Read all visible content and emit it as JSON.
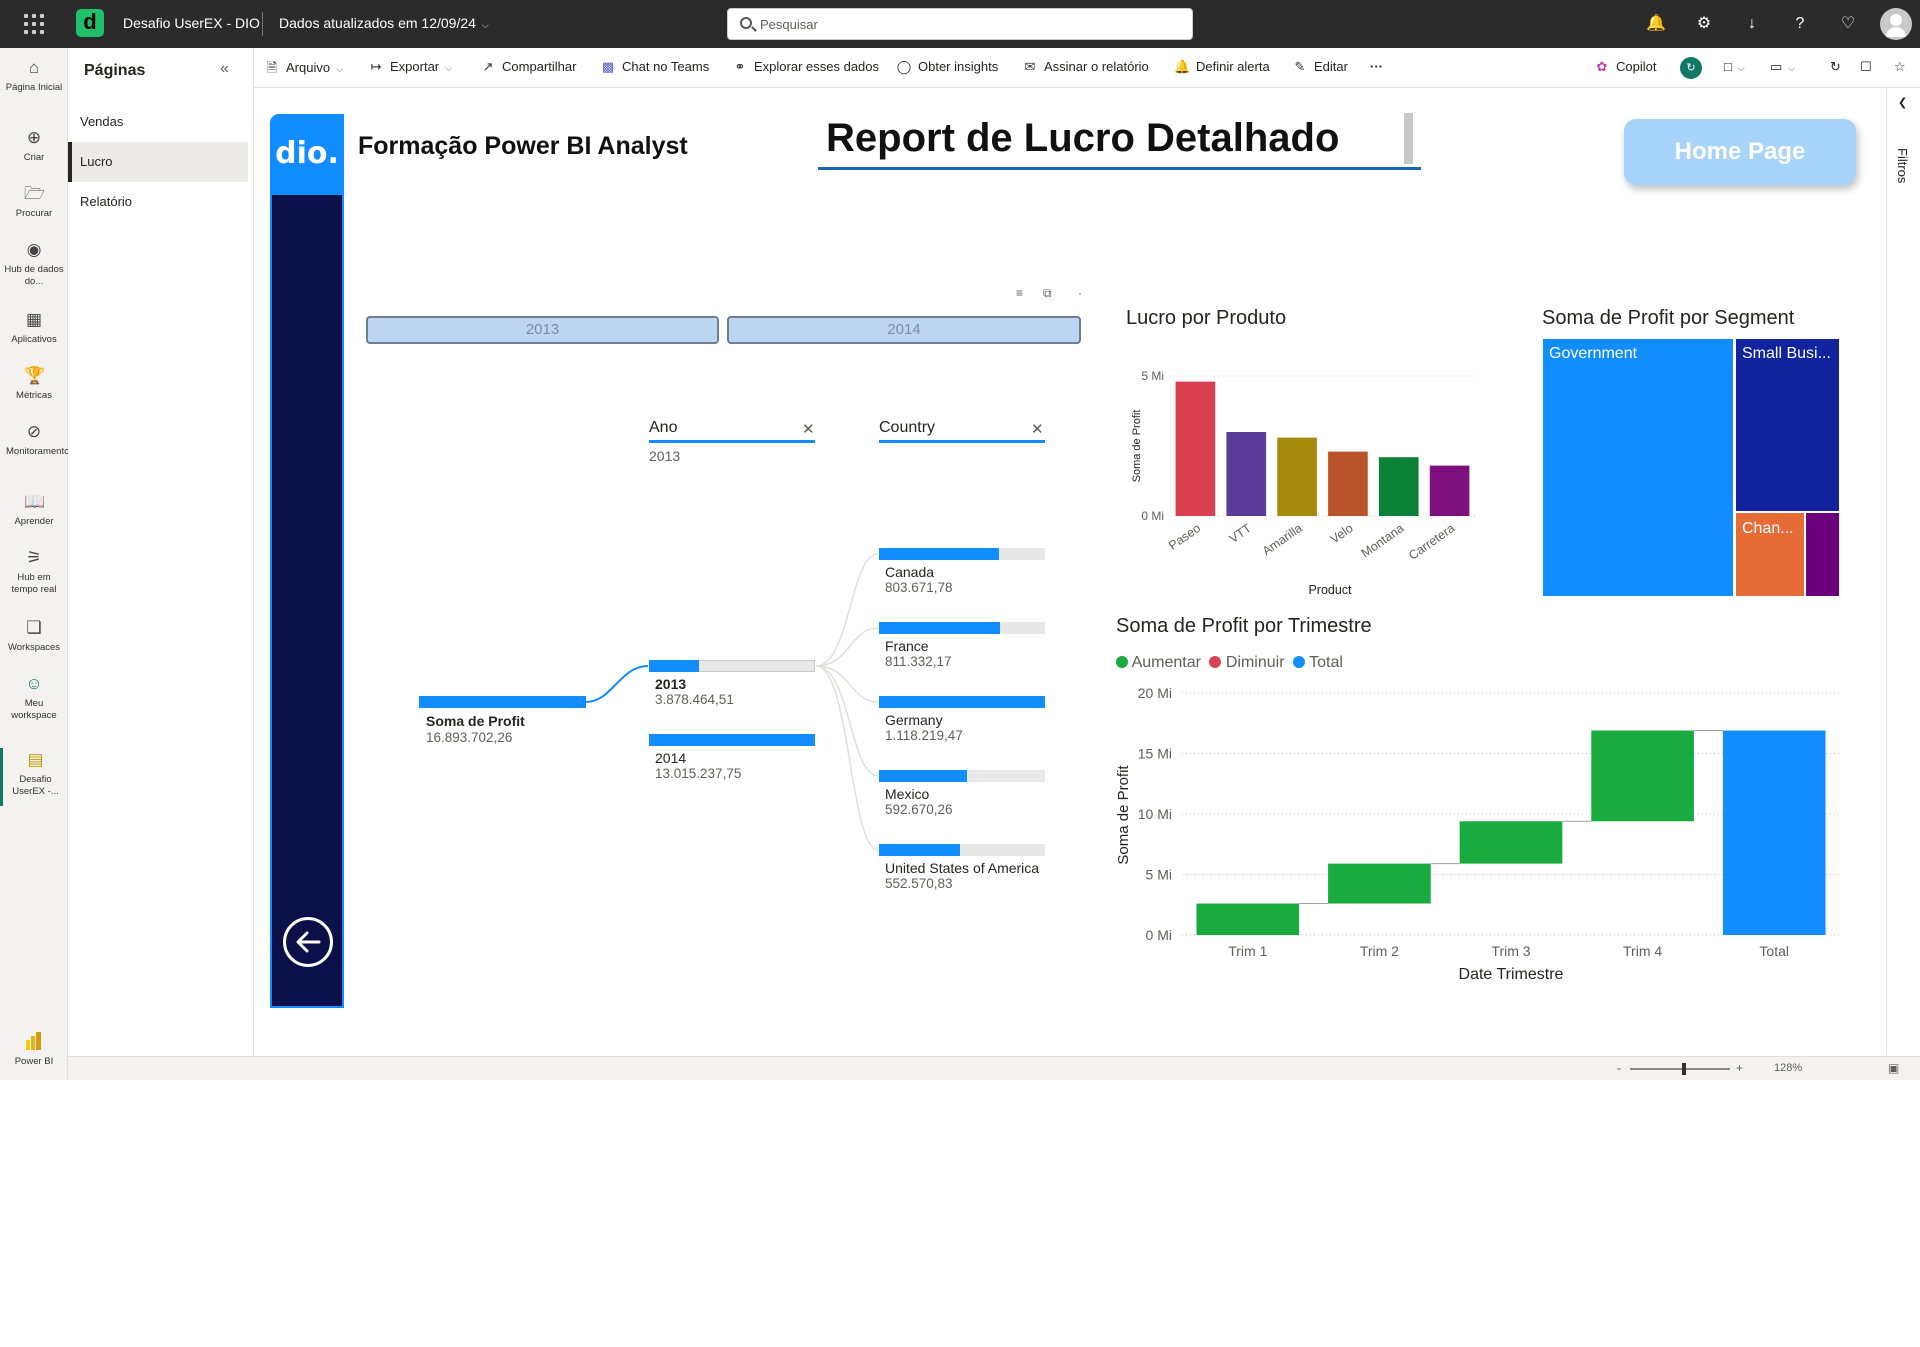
{
  "topbar": {
    "workspace_title": "Desafio UserEX - DIO",
    "updated_label": "Dados atualizados em 12/09/24",
    "search_placeholder": "Pesquisar"
  },
  "leftnav": [
    {
      "label": "Página Inicial",
      "icon": "home-icon"
    },
    {
      "label": "Criar",
      "icon": "plus-circle-icon"
    },
    {
      "label": "Procurar",
      "icon": "folder-icon"
    },
    {
      "label": "Hub de dados do...",
      "icon": "data-hub-icon"
    },
    {
      "label": "Aplicativos",
      "icon": "apps-icon"
    },
    {
      "label": "Métricas",
      "icon": "trophy-icon"
    },
    {
      "label": "Monitoramento",
      "icon": "monitor-icon"
    },
    {
      "label": "Aprender",
      "icon": "book-icon"
    },
    {
      "label": "Hub em tempo real",
      "icon": "realtime-icon"
    },
    {
      "label": "Workspaces",
      "icon": "workspaces-icon"
    },
    {
      "label": "Meu workspace",
      "icon": "person-icon"
    },
    {
      "label": "Desafio UserEX -...",
      "icon": "report-icon"
    }
  ],
  "powerbi_label": "Power BI",
  "pages_pane": {
    "header": "Páginas",
    "items": [
      "Vendas",
      "Lucro",
      "Relatório"
    ],
    "active": "Lucro"
  },
  "commands": {
    "arquivo": "Arquivo",
    "exportar": "Exportar",
    "compartilhar": "Compartilhar",
    "chat_teams": "Chat no Teams",
    "explorar": "Explorar esses dados",
    "insights": "Obter insights",
    "assinar": "Assinar o relatório",
    "alerta": "Definir alerta",
    "editar": "Editar",
    "more": "···",
    "copilot": "Copilot"
  },
  "filters_label": "Filtros",
  "zoom": "128%",
  "report": {
    "logo_text": "dio.",
    "left_title": "Formação Power BI Analyst",
    "main_title": "Report de Lucro Detalhado",
    "home_button": "Home Page",
    "slicer": [
      "2013",
      "2014"
    ]
  },
  "decomp": {
    "col1_header": "Ano",
    "col1_filter": "2013",
    "col2_header": "Country",
    "root": {
      "label": "Soma de Profit",
      "value": "16.893.702,26"
    },
    "years": [
      {
        "label": "2013",
        "value": "3.878.464,51",
        "fraction": 0.3
      },
      {
        "label": "2014",
        "value": "13.015.237,75",
        "fraction": 1.0
      }
    ],
    "countries": [
      {
        "label": "Canada",
        "value": "803.671,78",
        "fraction": 0.72
      },
      {
        "label": "France",
        "value": "811.332,17",
        "fraction": 0.73
      },
      {
        "label": "Germany",
        "value": "1.118.219,47",
        "fraction": 1.0
      },
      {
        "label": "Mexico",
        "value": "592.670,26",
        "fraction": 0.53
      },
      {
        "label": "United States of America",
        "value": "552.570,83",
        "fraction": 0.49
      }
    ]
  },
  "chart_data": [
    {
      "type": "bar",
      "title": "Lucro por Produto",
      "xlabel": "Product",
      "ylabel": "Soma de Profit",
      "yticks": [
        "0 Mi",
        "5 Mi"
      ],
      "ylim": [
        0,
        5
      ],
      "categories": [
        "Paseo",
        "VTT",
        "Amarilla",
        "Velo",
        "Montana",
        "Carretera"
      ],
      "values": [
        4.8,
        3.0,
        2.8,
        2.3,
        2.1,
        1.8
      ],
      "colors": [
        "#d9404f",
        "#5b3c99",
        "#a4890a",
        "#b9532a",
        "#0a8136",
        "#7f117e"
      ]
    },
    {
      "type": "heatmap",
      "subtype": "treemap",
      "title": "Soma de Profit por Segment",
      "cells": [
        {
          "label": "Government",
          "color": "#118dff"
        },
        {
          "label": "Small Busi...",
          "color": "#12239e"
        },
        {
          "label": "Chan...",
          "color": "#e66c37"
        },
        {
          "label": "",
          "color": "#6b007b"
        }
      ]
    },
    {
      "type": "bar",
      "subtype": "waterfall",
      "title": "Soma de Profit por Trimestre",
      "xlabel": "Date Trimestre",
      "ylabel": "Soma de Profit",
      "legend": [
        {
          "name": "Aumentar",
          "color": "#1aab40"
        },
        {
          "name": "Diminuir",
          "color": "#d64554"
        },
        {
          "name": "Total",
          "color": "#118dff"
        }
      ],
      "yticks": [
        "0 Mi",
        "5 Mi",
        "10 Mi",
        "15 Mi",
        "20 Mi"
      ],
      "ylim": [
        0,
        20
      ],
      "categories": [
        "Trim 1",
        "Trim 2",
        "Trim 3",
        "Trim 4",
        "Total"
      ],
      "values": [
        2.6,
        3.3,
        3.5,
        7.5,
        16.9
      ]
    }
  ]
}
